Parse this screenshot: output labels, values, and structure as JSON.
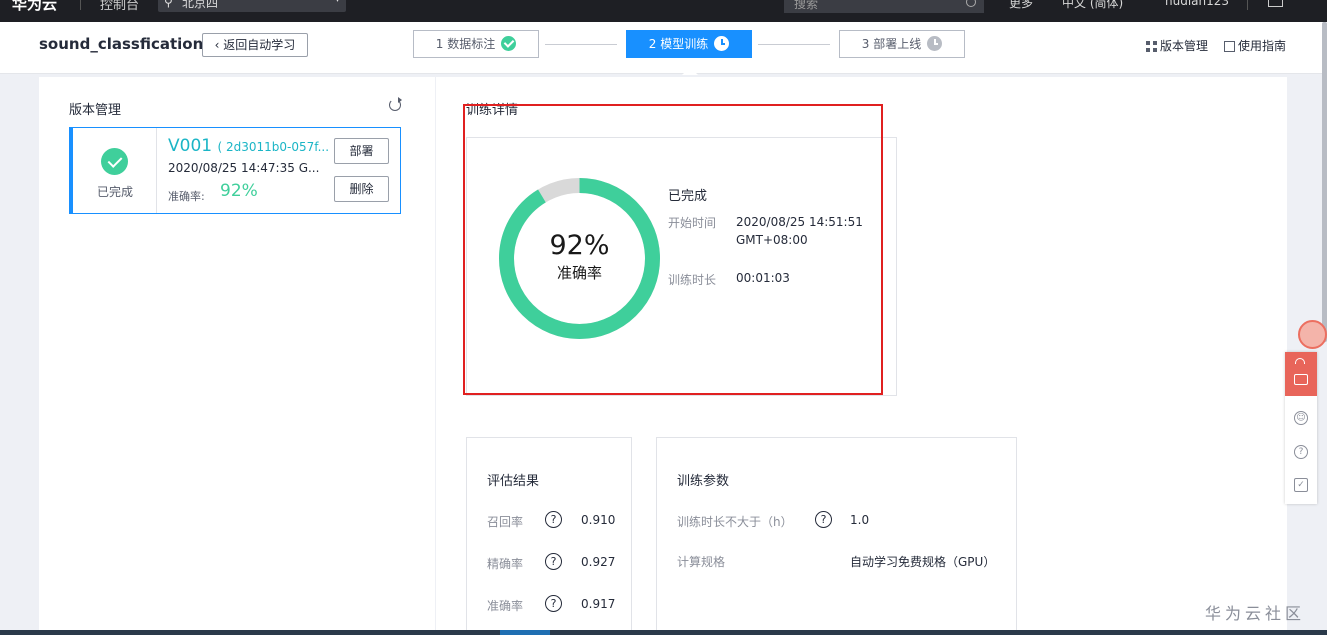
{
  "topbar": {
    "logo": "华为云",
    "console": "控制台",
    "region": "北京四",
    "search_placeholder": "搜索",
    "more": "更多",
    "language": "中文 (简体)",
    "user": "hudian123"
  },
  "header": {
    "project_title": "sound_classfication",
    "back_button": "返回自动学习",
    "steps": [
      {
        "label": "1 数据标注",
        "status": "done",
        "icon": "check-circle-icon"
      },
      {
        "label": "2 模型训练",
        "status": "active",
        "icon": "clock-icon"
      },
      {
        "label": "3 部署上线",
        "status": "pending",
        "icon": "clock-icon"
      }
    ],
    "version_manage_link": "版本管理",
    "guide_link": "使用指南"
  },
  "version_panel": {
    "title": "版本管理",
    "versions": [
      {
        "status": "已完成",
        "name": "V001",
        "id": "( 2d3011b0-057f...",
        "time": "2020/08/25 14:47:35 G...",
        "accuracy_label": "准确率:",
        "accuracy": "92%",
        "deploy_button": "部署",
        "delete_button": "删除"
      }
    ]
  },
  "train_detail": {
    "title": "训练详情",
    "accuracy_pct": "92%",
    "accuracy_value": 0.92,
    "accuracy_label": "准确率",
    "status": "已完成",
    "start_time_label": "开始时间",
    "start_time_line1": "2020/08/25 14:51:51",
    "start_time_line2": "GMT+08:00",
    "duration_label": "训练时长",
    "duration": "00:01:03",
    "colors": {
      "ring": "#3fcf9b",
      "ring_rest": "#d9d9d9"
    }
  },
  "evaluation": {
    "title": "评估结果",
    "rows": [
      {
        "label": "召回率",
        "value": "0.910"
      },
      {
        "label": "精确率",
        "value": "0.927"
      },
      {
        "label": "准确率",
        "value": "0.917"
      }
    ]
  },
  "params": {
    "title": "训练参数",
    "rows": [
      {
        "label": "训练时长不大于（h）",
        "has_help": true,
        "value": "1.0"
      },
      {
        "label": "计算规格",
        "has_help": false,
        "value": "自动学习免费规格（GPU）"
      }
    ]
  },
  "watermark": "华为云社区"
}
